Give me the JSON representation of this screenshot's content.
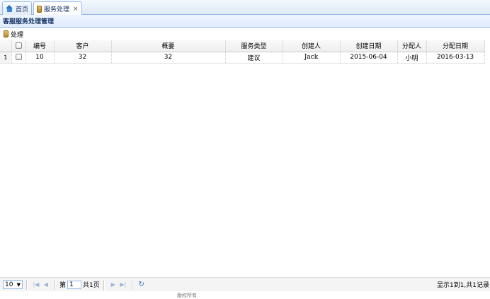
{
  "tabs": [
    {
      "label": "首页",
      "icon": "home-icon"
    },
    {
      "label": "服务处理",
      "icon": "jar-icon",
      "close": "×"
    }
  ],
  "panel": {
    "title": "客服服务处理管理"
  },
  "toolbar": {
    "process_label": "处理"
  },
  "grid": {
    "columns": [
      "编号",
      "客户",
      "概要",
      "服务类型",
      "创建人",
      "创建日期",
      "分配人",
      "分配日期"
    ],
    "rows": [
      {
        "rownum": "1",
        "cells": [
          "10",
          "32",
          "32",
          "建议",
          "Jack",
          "2015-06-04",
          "小明",
          "2016-03-13"
        ]
      }
    ]
  },
  "pager": {
    "page_size": "10",
    "page_prefix": "第",
    "page_value": "1",
    "page_suffix": "共1页",
    "info": "显示1到1,共1记录"
  },
  "footer": {
    "text": "版权所有"
  }
}
